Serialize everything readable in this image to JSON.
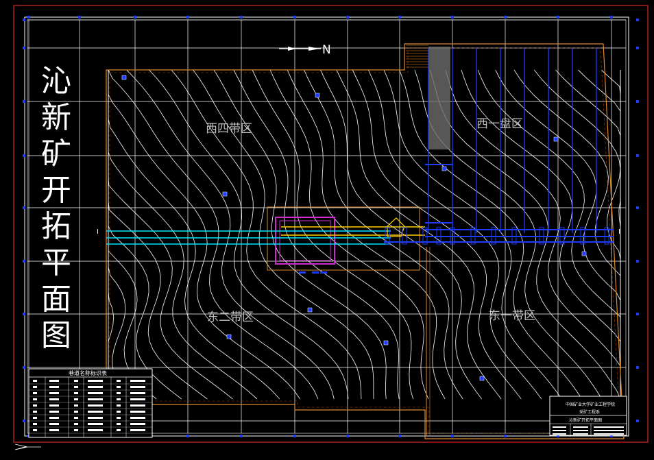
{
  "drawing": {
    "title_chars": [
      "沁",
      "新",
      "矿",
      "开",
      "拓",
      "平",
      "面",
      "图"
    ],
    "north_label": "N",
    "zones": {
      "west_four": "西四带区",
      "west_one": "西一盘区",
      "east_two": "东二带区",
      "east_one": "东一带区"
    },
    "section_marker_left": "I",
    "section_marker_right": "I",
    "legend_table_title": "巷道名称标识表",
    "title_block": {
      "line1": "中国矿业大学矿业工程学院",
      "line2": "采矿工程系",
      "line3": "沁新矿开拓平面图"
    },
    "colors": {
      "background": "#000000",
      "frame": "#ffffff",
      "grid": "#ffffff",
      "contour": "#ffffff",
      "boundary": "#e08a2a",
      "roadway_cyan": "#00e5ff",
      "roadway_blue": "#1f3cff",
      "roadway_yellow": "#ffd000",
      "shaft_magenta": "#d02ad0",
      "zone_label": "#bfbfbf"
    }
  }
}
